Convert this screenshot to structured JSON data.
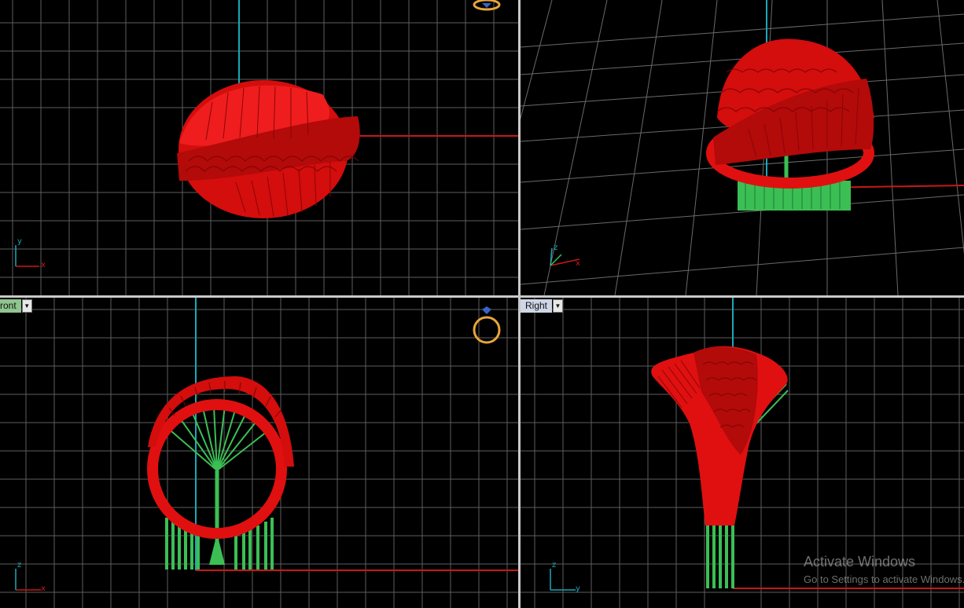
{
  "viewports": {
    "top": {
      "label": ""
    },
    "perspective": {
      "label": ""
    },
    "front": {
      "label": "Front",
      "label_visible": "ront"
    },
    "right": {
      "label": "Right"
    }
  },
  "axes": {
    "top": {
      "a": "y",
      "b": "x"
    },
    "perspective": {
      "a": "z",
      "b": "x"
    },
    "front": {
      "a": "z",
      "b": "x"
    },
    "right": {
      "a": "z",
      "b": "y"
    }
  },
  "watermark": {
    "title": "Activate Windows",
    "subtitle": "Go to Settings to activate Windows."
  },
  "colors": {
    "background": "#000000",
    "grid": "#6a6a6a",
    "grid_major": "#9a9a9a",
    "model_red": "#e01010",
    "support_green": "#3bbf55",
    "axis_x": "#c81818",
    "axis_y_or_z": "#1ba7b8",
    "ring_icon": "#e7a53a"
  },
  "icons": {
    "dropdown": "chevron-down-icon",
    "ring": "ring-icon"
  }
}
